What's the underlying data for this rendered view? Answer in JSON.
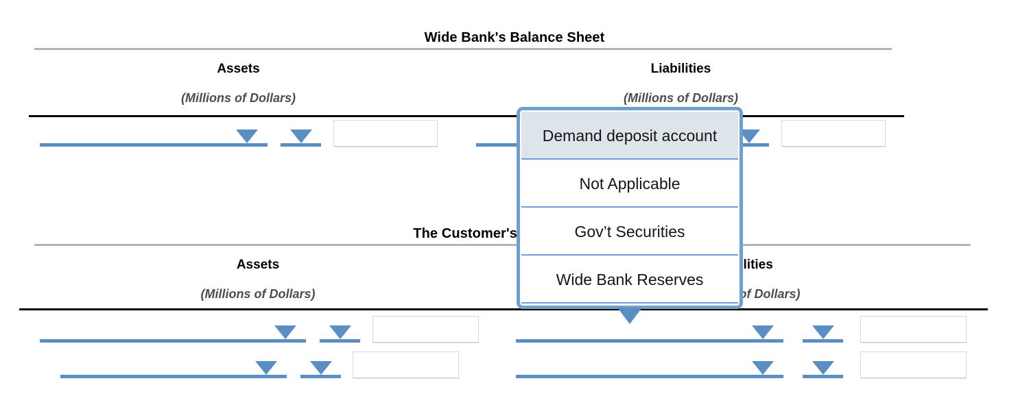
{
  "sheets": [
    {
      "title": "Wide Bank's Balance Sheet",
      "columns": [
        {
          "heading": "Assets",
          "units": "(Millions of Dollars)"
        },
        {
          "heading": "Liabilities",
          "units": "(Millions of Dollars)"
        }
      ],
      "rows": [
        {
          "left": {
            "item_select": "",
            "amount_select": "",
            "amount_input": ""
          },
          "right": {
            "item_select": "",
            "amount_select": "",
            "amount_input": ""
          }
        }
      ]
    },
    {
      "title": "The Customer's Balance Sheet",
      "columns": [
        {
          "heading": "Assets",
          "units": "(Millions of Dollars)"
        },
        {
          "heading": "Liabilities",
          "units": "(Millions of Dollars)"
        }
      ],
      "rows": [
        {
          "left": {
            "item_select": "",
            "amount_select": "",
            "amount_input": ""
          },
          "right": {
            "item_select": "",
            "amount_select": "",
            "amount_input": ""
          }
        },
        {
          "left": {
            "item_select": "",
            "amount_select": "",
            "amount_input": ""
          },
          "right": {
            "item_select": "",
            "amount_select": "",
            "amount_input": ""
          }
        }
      ]
    }
  ],
  "dropdown": {
    "open": true,
    "selected": "Demand deposit account",
    "options": [
      {
        "label": "Demand deposit account",
        "selected": true
      },
      {
        "label": "Not Applicable",
        "selected": false
      },
      {
        "label": "Gov’t Securities",
        "selected": false
      },
      {
        "label": "Wide Bank Reserves",
        "selected": false
      }
    ]
  },
  "colors": {
    "accent_blue": "#5b8fc4",
    "dropdown_border": "#6f9fd0",
    "dropdown_highlight": "#dde5ea",
    "rule_gray": "#b3b3b5",
    "rule_black": "#000000",
    "units_text": "#4d4d4d"
  },
  "icons": {
    "dropdown_arrow": "chevron-down-icon",
    "popup_tail": "popup-pointer-icon"
  }
}
